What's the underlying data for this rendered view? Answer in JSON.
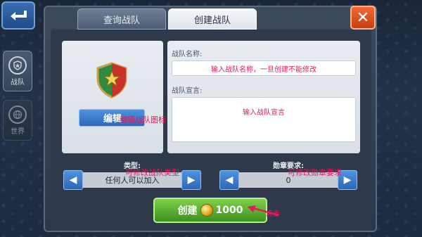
{
  "nav": {
    "back_icon": "back-arrow-icon",
    "side_tabs": [
      {
        "label": "战队",
        "icon": "shield-icon",
        "active": true
      },
      {
        "label": "世界",
        "icon": "globe-icon",
        "active": false
      }
    ]
  },
  "tabs": [
    {
      "label": "查询战队",
      "active": false
    },
    {
      "label": "创建战队",
      "active": true
    }
  ],
  "close_icon": "close-icon",
  "emblem": {
    "edit_label": "编辑",
    "edit_hint": "编辑战队图标"
  },
  "form": {
    "name_label": "战队名称:",
    "name_placeholder": "输入战队名称，一旦创建不能修改",
    "declaration_label": "战队宣言:",
    "declaration_placeholder": "输入战队宣言"
  },
  "type_selector": {
    "title": "类型:",
    "value": "任何人可以加入",
    "hint": "可修改战队类型"
  },
  "medal_selector": {
    "title": "勋章要求:",
    "value": "0",
    "hint": "可修改勋章要求"
  },
  "create_button": {
    "label": "创建",
    "cost": "1000",
    "hint": "点击"
  },
  "colors": {
    "accent_blue": "#2c68b6",
    "create_green": "#3c8f1f",
    "close_orange": "#c3410f",
    "hint_pink": "#e8195a"
  }
}
